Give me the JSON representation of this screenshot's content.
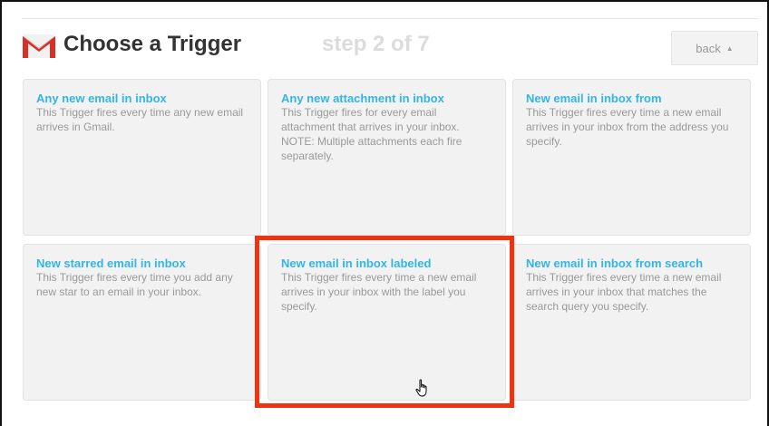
{
  "header": {
    "title": "Choose a Trigger",
    "step": "step 2 of 7",
    "back_label": "back",
    "icon": "gmail-icon"
  },
  "cards": [
    {
      "title": "Any new email in inbox",
      "description": "This Trigger fires every time any new email arrives in Gmail."
    },
    {
      "title": "Any new attachment in inbox",
      "description": "This Trigger fires for every email attachment that arrives in your inbox. NOTE: Multiple attachments each fire separately."
    },
    {
      "title": "New email in inbox from",
      "description": "This Trigger fires every time a new email arrives in your inbox from the address you specify."
    },
    {
      "title": "New starred email in inbox",
      "description": "This Trigger fires every time you add any new star to an email in your inbox."
    },
    {
      "title": "New email in inbox labeled",
      "description": "This Trigger fires every time a new email arrives in your inbox with the label you specify.",
      "highlighted": true
    },
    {
      "title": "New email in inbox from search",
      "description": "This Trigger fires every time a new email arrives in your inbox that matches the search query you specify."
    }
  ],
  "colors": {
    "card_title": "#33b5e5",
    "highlight": "#f2320f",
    "gmail_red": "#d93025"
  }
}
